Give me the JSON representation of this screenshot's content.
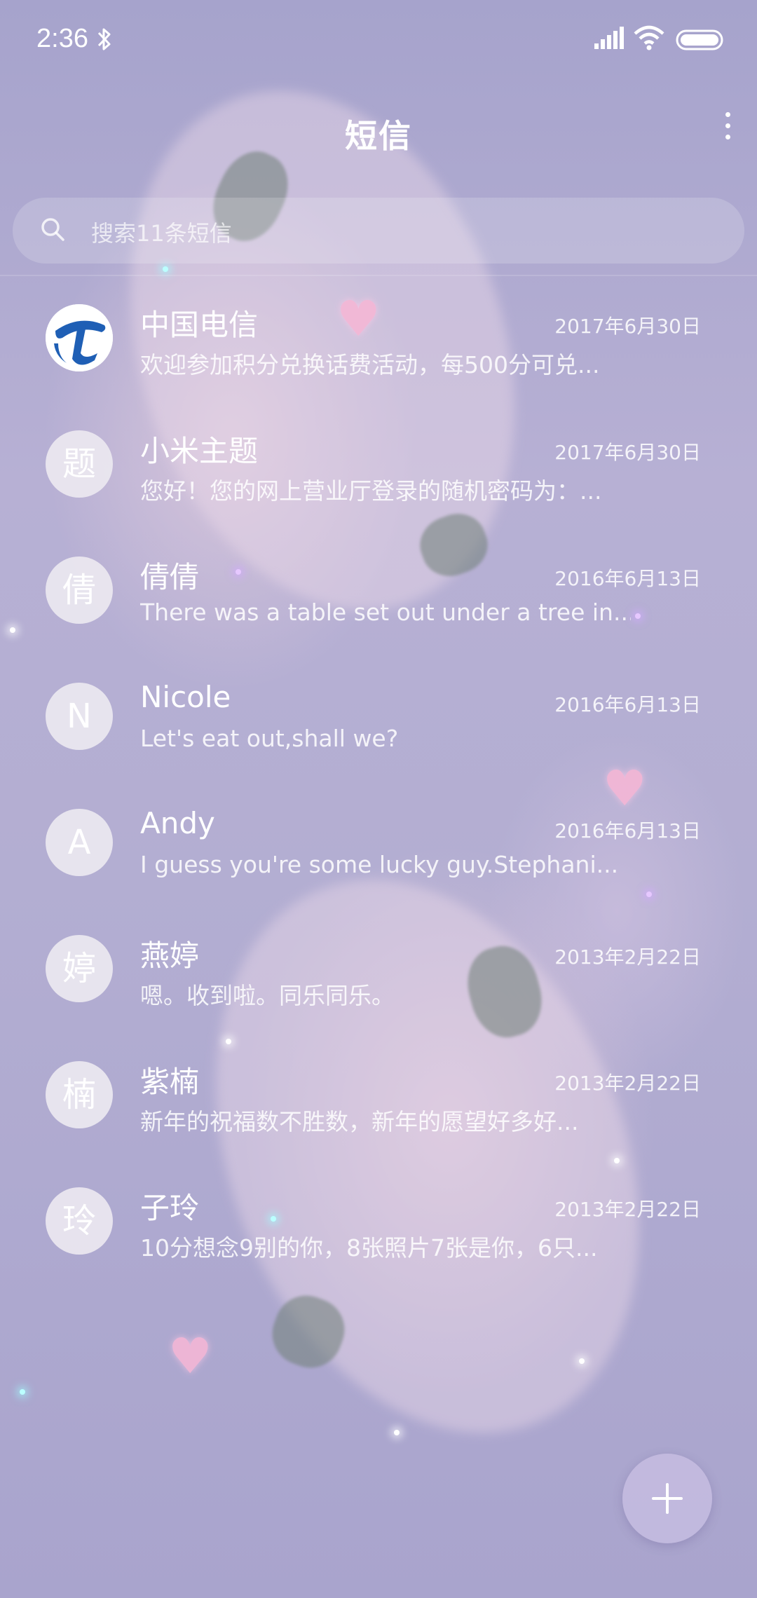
{
  "status_bar": {
    "time": "2:36"
  },
  "header": {
    "title": "短信"
  },
  "search": {
    "placeholder": "搜索11条短信"
  },
  "conversations": [
    {
      "name": "中国电信",
      "avatar": "",
      "avatar_icon": "china-telecom-logo",
      "date": "2017年6月30日",
      "preview": "欢迎参加积分兑换话费活动，每500分可兑..."
    },
    {
      "name": "小米主题",
      "avatar": "题",
      "date": "2017年6月30日",
      "preview": "您好！您的网上营业厅登录的随机密码为：..."
    },
    {
      "name": "倩倩",
      "avatar": "倩",
      "date": "2016年6月13日",
      "preview": "There was a table set out under a tree in..."
    },
    {
      "name": "Nicole",
      "avatar": "N",
      "date": "2016年6月13日",
      "preview": "Let's eat out,shall we?"
    },
    {
      "name": "Andy",
      "avatar": "A",
      "date": "2016年6月13日",
      "preview": "I guess you're some lucky guy.Stephani..."
    },
    {
      "name": "燕婷",
      "avatar": "婷",
      "date": "2013年2月22日",
      "preview": "嗯。收到啦。同乐同乐。"
    },
    {
      "name": "紫楠",
      "avatar": "楠",
      "date": "2013年2月22日",
      "preview": "新年的祝福数不胜数，新年的愿望好多好..."
    },
    {
      "name": "子玲",
      "avatar": "玲",
      "date": "2013年2月22日",
      "preview": "10分想念9别的你，8张照片7张是你，6只..."
    }
  ],
  "colors": {
    "background": "#b0abd1",
    "telecom_blue": "#1f5fb5"
  }
}
